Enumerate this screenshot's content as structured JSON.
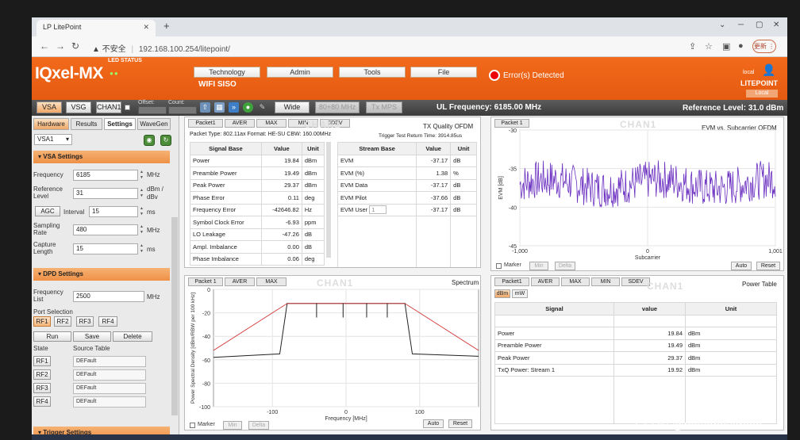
{
  "browser": {
    "tab_title": "LP  LitePoint",
    "url_warning": "▲ 不安全",
    "url": "192.168.100.254/litepoint/",
    "profile_label": "更新 ⋮"
  },
  "header": {
    "logo": "IQxel-MX",
    "led_status": "LED STATUS",
    "menu": [
      "Technology",
      "Admin",
      "Tools",
      "File"
    ],
    "subtitle": "WIFI SISO",
    "error_text": "Error(s) Detected",
    "local_top": "local",
    "brand": "LITEPOINT",
    "local_bottom": "Local"
  },
  "toolbar": {
    "vsa": "VSA",
    "vsg": "VSG",
    "chan": "CHAN1",
    "offset_label": "Offset:",
    "count_label": "Count:",
    "wide": "Wide",
    "mode_8080": "80+80 MHz",
    "tx_mps": "Tx MPS",
    "ul_freq": "UL Frequency: 6185.00 MHz",
    "ref_level": "Reference Level: 31.0 dBm"
  },
  "left": {
    "tabs": [
      "Hardware",
      "Results",
      "Settings",
      "WaveGen"
    ],
    "vsa_select": "VSA1",
    "vsa_settings_title": "VSA Settings",
    "frequency_label": "Frequency",
    "frequency_value": "6185",
    "frequency_unit": "MHz",
    "reflevel_label": "Reference Level",
    "reflevel_value": "31",
    "reflevel_unit": "dBm / dBv",
    "agc": "AGC",
    "interval_label": "Interval",
    "interval_value": "15",
    "interval_unit": "ms",
    "sampling_label": "Sampling Rate",
    "sampling_value": "480",
    "sampling_unit": "MHz",
    "capture_label": "Capture Length",
    "capture_value": "15",
    "capture_unit": "ms",
    "dpd_title": "DPD Settings",
    "freqlist_label": "Frequency List",
    "freqlist_value": "2500",
    "freqlist_unit": "MHz",
    "port_label": "Port Selection",
    "ports": [
      "RF1",
      "RF2",
      "RF3",
      "RF4"
    ],
    "actions": [
      "Run",
      "Save",
      "Delete"
    ],
    "state_label": "State",
    "source_label": "Source Table",
    "state_rows": [
      {
        "port": "RF1",
        "source": "DEFault"
      },
      {
        "port": "RF2",
        "source": "DEFault"
      },
      {
        "port": "RF3",
        "source": "DEFault"
      },
      {
        "port": "RF4",
        "source": "DEFault"
      }
    ],
    "trigger_title": "Trigger Settings"
  },
  "txq": {
    "tabs": [
      "Packet1",
      "AVER",
      "MAX",
      "MIN",
      "SDEV"
    ],
    "title": "TX Quality OFDM",
    "chan": "CHAN1",
    "packet_type": "Packet Type: 802.11ax Format: HE-SU CBW: 160.00MHz",
    "trigger_time": "Trigger Test Return Time: 3914.85us",
    "signal_headers": [
      "Signal Base",
      "Value",
      "Unit"
    ],
    "signal_rows": [
      [
        "Power",
        "19.84",
        "dBm"
      ],
      [
        "Preamble Power",
        "19.49",
        "dBm"
      ],
      [
        "Peak Power",
        "29.37",
        "dBm"
      ],
      [
        "Phase Error",
        "0.11",
        "deg"
      ],
      [
        "Frequency Error",
        "-42646.82",
        "Hz"
      ],
      [
        "Symbol Clock Error",
        "-6.93",
        "ppm"
      ],
      [
        "LO Leakage",
        "-47.26",
        "dB"
      ],
      [
        "Ampl. Imbalance",
        "0.00",
        "dB"
      ],
      [
        "Phase Imbalance",
        "0.06",
        "deg"
      ]
    ],
    "stream_headers": [
      "Stream Base",
      "Value",
      "Unit"
    ],
    "stream_rows": [
      [
        "EVM",
        "-37.17",
        "dB"
      ],
      [
        "EVM (%)",
        "1.38",
        "%"
      ],
      [
        "EVM Data",
        "-37.17",
        "dB"
      ],
      [
        "EVM Pilot",
        "-37.66",
        "dB"
      ],
      [
        "EVM User",
        "-37.17",
        "dB"
      ]
    ],
    "user_select": "1"
  },
  "evm": {
    "tab": "Packet 1",
    "chan": "CHAN1",
    "title": "EVM vs. Subcarrier OFDM",
    "marker": "Marker",
    "min": "Min",
    "delta": "Delta",
    "auto": "Auto",
    "reset": "Reset",
    "chart_data": {
      "type": "line",
      "title": "EVM vs. Subcarrier OFDM",
      "xlabel": "Subcarrier",
      "ylabel": "EVM [dB]",
      "xlim": [
        -1000,
        1000
      ],
      "ylim": [
        -45,
        -30
      ],
      "x_ticks": [
        "-1,000",
        "0",
        "1,001"
      ],
      "y_ticks": [
        "-30",
        "-35",
        "-40",
        "-45"
      ],
      "series": [
        {
          "values_summary": {
            "mean": -37,
            "spread": 2.5
          },
          "color": "#6a2fc0"
        }
      ]
    }
  },
  "spectrum": {
    "tabs": [
      "Packet 1",
      "AVER",
      "MAX"
    ],
    "chan": "CHAN1",
    "title": "Spectrum",
    "marker": "Marker",
    "min": "Min",
    "delta": "Delta",
    "auto": "Auto",
    "reset": "Reset",
    "chart_data": {
      "type": "line",
      "title": "Spectrum",
      "xlabel": "Frequency [MHz]",
      "ylabel": "Power Spectral Density [dBm/RBW per 100 kHz]",
      "xlim": [
        -180,
        180
      ],
      "ylim": [
        -100,
        0
      ],
      "x_ticks": [
        "-100",
        "0",
        "100"
      ],
      "y_ticks": [
        "0",
        "-20",
        "-40",
        "-60",
        "-80",
        "-100"
      ],
      "series": [
        {
          "points": [
            [
              -180,
              -58
            ],
            [
              -90,
              -55
            ],
            [
              -80,
              -12
            ],
            [
              80,
              -12
            ],
            [
              90,
              -55
            ],
            [
              180,
              -57
            ]
          ],
          "color": "#222222"
        },
        {
          "points": [
            [
              -180,
              -52
            ],
            [
              -80,
              -12
            ],
            [
              80,
              -12
            ],
            [
              180,
              -52
            ]
          ],
          "color": "#d03030"
        }
      ]
    }
  },
  "power": {
    "tabs": [
      "Packet1",
      "AVER",
      "MAX",
      "MIN",
      "SDEV"
    ],
    "chan": "CHAN1",
    "title": "Power Table",
    "units": [
      "dBm",
      "mW"
    ],
    "headers": [
      "Signal",
      "value",
      "Unit"
    ],
    "rows": [
      [
        "Power",
        "19.84",
        "dBm"
      ],
      [
        "Preamble Power",
        "19.49",
        "dBm"
      ],
      [
        "Peak Power",
        "29.37",
        "dBm"
      ],
      [
        "TxQ Power: Stream 1",
        "19.92",
        "dBm"
      ]
    ]
  },
  "watermark": "CSDN @matlabaverson",
  "colors": {
    "accent": "#e55a10",
    "evm_trace": "#6a2fc0",
    "mask": "#d03030"
  }
}
